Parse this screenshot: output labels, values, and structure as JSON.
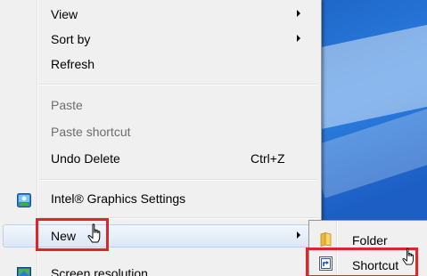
{
  "menu": {
    "items": [
      {
        "label": "View",
        "submenu": true
      },
      {
        "label": "Sort by",
        "submenu": true
      },
      {
        "label": "Refresh"
      },
      {
        "label": "Paste",
        "disabled": true
      },
      {
        "label": "Paste shortcut",
        "disabled": true
      },
      {
        "label": "Undo Delete",
        "shortcut": "Ctrl+Z"
      },
      {
        "label": "Intel® Graphics Settings",
        "icon": "intel-graphics-icon"
      },
      {
        "label": "New",
        "submenu": true,
        "highlighted": true
      },
      {
        "label": "Screen resolution",
        "icon": "screen-resolution-icon"
      }
    ]
  },
  "submenu": {
    "items": [
      {
        "label": "Folder",
        "icon": "folder-icon"
      },
      {
        "label": "Shortcut",
        "icon": "shortcut-icon",
        "highlighted": true
      }
    ]
  },
  "colors": {
    "highlight_box": "#e0252a",
    "menu_bg": "#f0f0f0",
    "desktop_blue": "#1f67c9"
  },
  "cursor": "hand-pointer-icon"
}
